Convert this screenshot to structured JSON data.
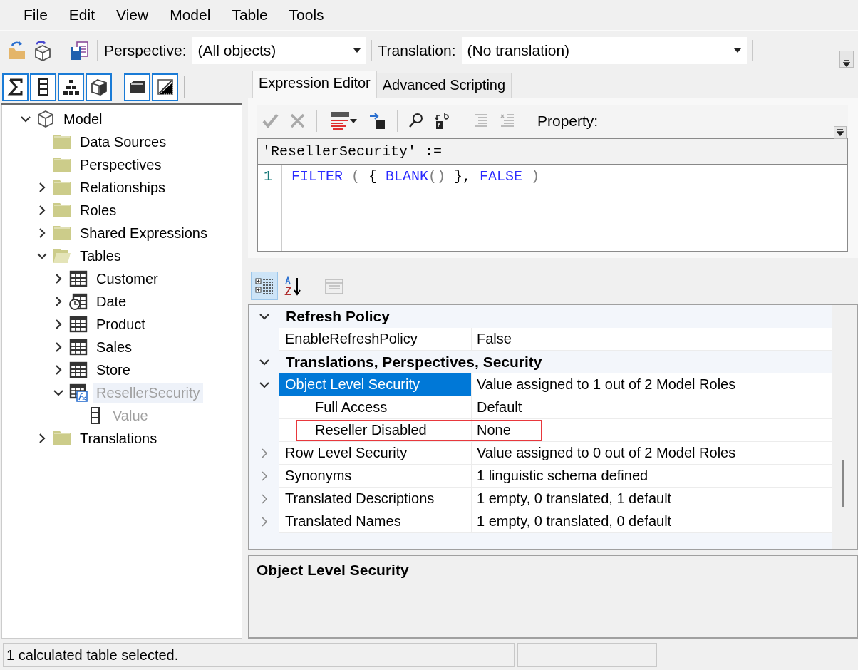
{
  "menu": [
    {
      "label": "File"
    },
    {
      "label": "Edit"
    },
    {
      "label": "View"
    },
    {
      "label": "Model"
    },
    {
      "label": "Table"
    },
    {
      "label": "Tools"
    }
  ],
  "toolbar": {
    "perspective_label": "Perspective:",
    "perspective_value": "(All objects)",
    "translation_label": "Translation:",
    "translation_value": "(No translation)"
  },
  "view_toggles": [
    {
      "kind": "sigma",
      "checked": true
    },
    {
      "kind": "column",
      "checked": true
    },
    {
      "kind": "hierarchy",
      "checked": true
    },
    {
      "kind": "cube",
      "checked": true
    },
    {
      "kind": "folder",
      "checked": true
    },
    {
      "kind": "hidden",
      "checked": true
    }
  ],
  "tree": [
    {
      "label": "Model",
      "kind": "model",
      "expanded": true,
      "selected": false,
      "dimmed": false,
      "children": [
        {
          "label": "Data Sources",
          "kind": "folder",
          "selected": false,
          "dimmed": false
        },
        {
          "label": "Perspectives",
          "kind": "folder",
          "selected": false,
          "dimmed": false
        },
        {
          "label": "Relationships",
          "kind": "folder",
          "expanded": false,
          "selected": false,
          "dimmed": false
        },
        {
          "label": "Roles",
          "kind": "folder",
          "expanded": false,
          "selected": false,
          "dimmed": false
        },
        {
          "label": "Shared Expressions",
          "kind": "folder",
          "expanded": false,
          "selected": false,
          "dimmed": false
        },
        {
          "label": "Tables",
          "kind": "folder",
          "expanded": true,
          "selected": false,
          "dimmed": false,
          "children": [
            {
              "label": "Customer",
              "kind": "table",
              "expanded": false,
              "selected": false,
              "dimmed": false
            },
            {
              "label": "Date",
              "kind": "date-table",
              "expanded": false,
              "selected": false,
              "dimmed": false
            },
            {
              "label": "Product",
              "kind": "table",
              "expanded": false,
              "selected": false,
              "dimmed": false
            },
            {
              "label": "Sales",
              "kind": "table",
              "expanded": false,
              "selected": false,
              "dimmed": false
            },
            {
              "label": "Store",
              "kind": "table",
              "expanded": false,
              "selected": false,
              "dimmed": false
            },
            {
              "label": "ResellerSecurity",
              "kind": "calc-table",
              "expanded": true,
              "selected": true,
              "dimmed": true,
              "children": [
                {
                  "label": "Value",
                  "kind": "column",
                  "selected": false,
                  "dimmed": true
                }
              ]
            }
          ]
        },
        {
          "label": "Translations",
          "kind": "folder",
          "expanded": false,
          "selected": false,
          "dimmed": false
        }
      ]
    }
  ],
  "tabs": [
    {
      "label": "Expression Editor",
      "selected": true
    },
    {
      "label": "Advanced Scripting",
      "selected": false
    }
  ],
  "expression_toolbar": {
    "buttons": [
      {
        "kind": "accept",
        "disabled": true
      },
      {
        "kind": "cancel",
        "disabled": true
      },
      {
        "kind": "dax-format",
        "disabled": false
      },
      {
        "kind": "dependencies",
        "disabled": false
      },
      {
        "kind": "find",
        "disabled": false
      },
      {
        "kind": "replace",
        "disabled": false
      },
      {
        "kind": "indent",
        "disabled": true
      },
      {
        "kind": "comment",
        "disabled": true
      }
    ],
    "property_label": "Property:"
  },
  "editor": {
    "header": "'ResellerSecurity' :=",
    "lines": [
      {
        "number": "1",
        "tokens": [
          {
            "text": "FILTER",
            "kind": "keyword"
          },
          {
            "text": " ( ",
            "kind": "paren"
          },
          {
            "text": "{ ",
            "kind": "plain"
          },
          {
            "text": "BLANK",
            "kind": "keyword"
          },
          {
            "text": "()",
            "kind": "paren"
          },
          {
            "text": " }, ",
            "kind": "plain"
          },
          {
            "text": "FALSE",
            "kind": "keyword"
          },
          {
            "text": " )",
            "kind": "paren"
          }
        ]
      }
    ]
  },
  "grid_toolbar": [
    {
      "kind": "categorized",
      "selected": true,
      "disabled": false
    },
    {
      "kind": "alphabetical",
      "selected": false,
      "disabled": false
    },
    {
      "kind": "property-pages",
      "selected": false,
      "disabled": true
    }
  ],
  "properties": [
    {
      "category": "Refresh Policy",
      "expanded": true,
      "rows": [
        {
          "name": "EnableRefreshPolicy",
          "value": "False",
          "selected": false
        }
      ]
    },
    {
      "category": "Translations, Perspectives, Security",
      "expanded": true,
      "rows": [
        {
          "name": "Object Level Security",
          "value": "Value assigned to 1 out of 2 Model Roles",
          "expanded": true,
          "selected": true,
          "children": [
            {
              "name": "Full Access",
              "value": "Default",
              "selected": false
            },
            {
              "name": "Reseller Disabled",
              "value": "None",
              "selected": false,
              "highlighted": true
            }
          ]
        },
        {
          "name": "Row Level Security",
          "value": "Value assigned to 0 out of 2 Model Roles",
          "expanded": false,
          "selected": false
        },
        {
          "name": "Synonyms",
          "value": "1 linguistic schema defined",
          "expanded": false,
          "selected": false
        },
        {
          "name": "Translated Descriptions",
          "value": "1 empty, 0 translated, 1 default",
          "expanded": false,
          "selected": false
        },
        {
          "name": "Translated Names",
          "value": "1 empty, 0 translated, 0 default",
          "expanded": false,
          "selected": false
        }
      ]
    }
  ],
  "description": {
    "title": "Object Level Security"
  },
  "status_bar": {
    "text": "1 calculated table selected."
  }
}
